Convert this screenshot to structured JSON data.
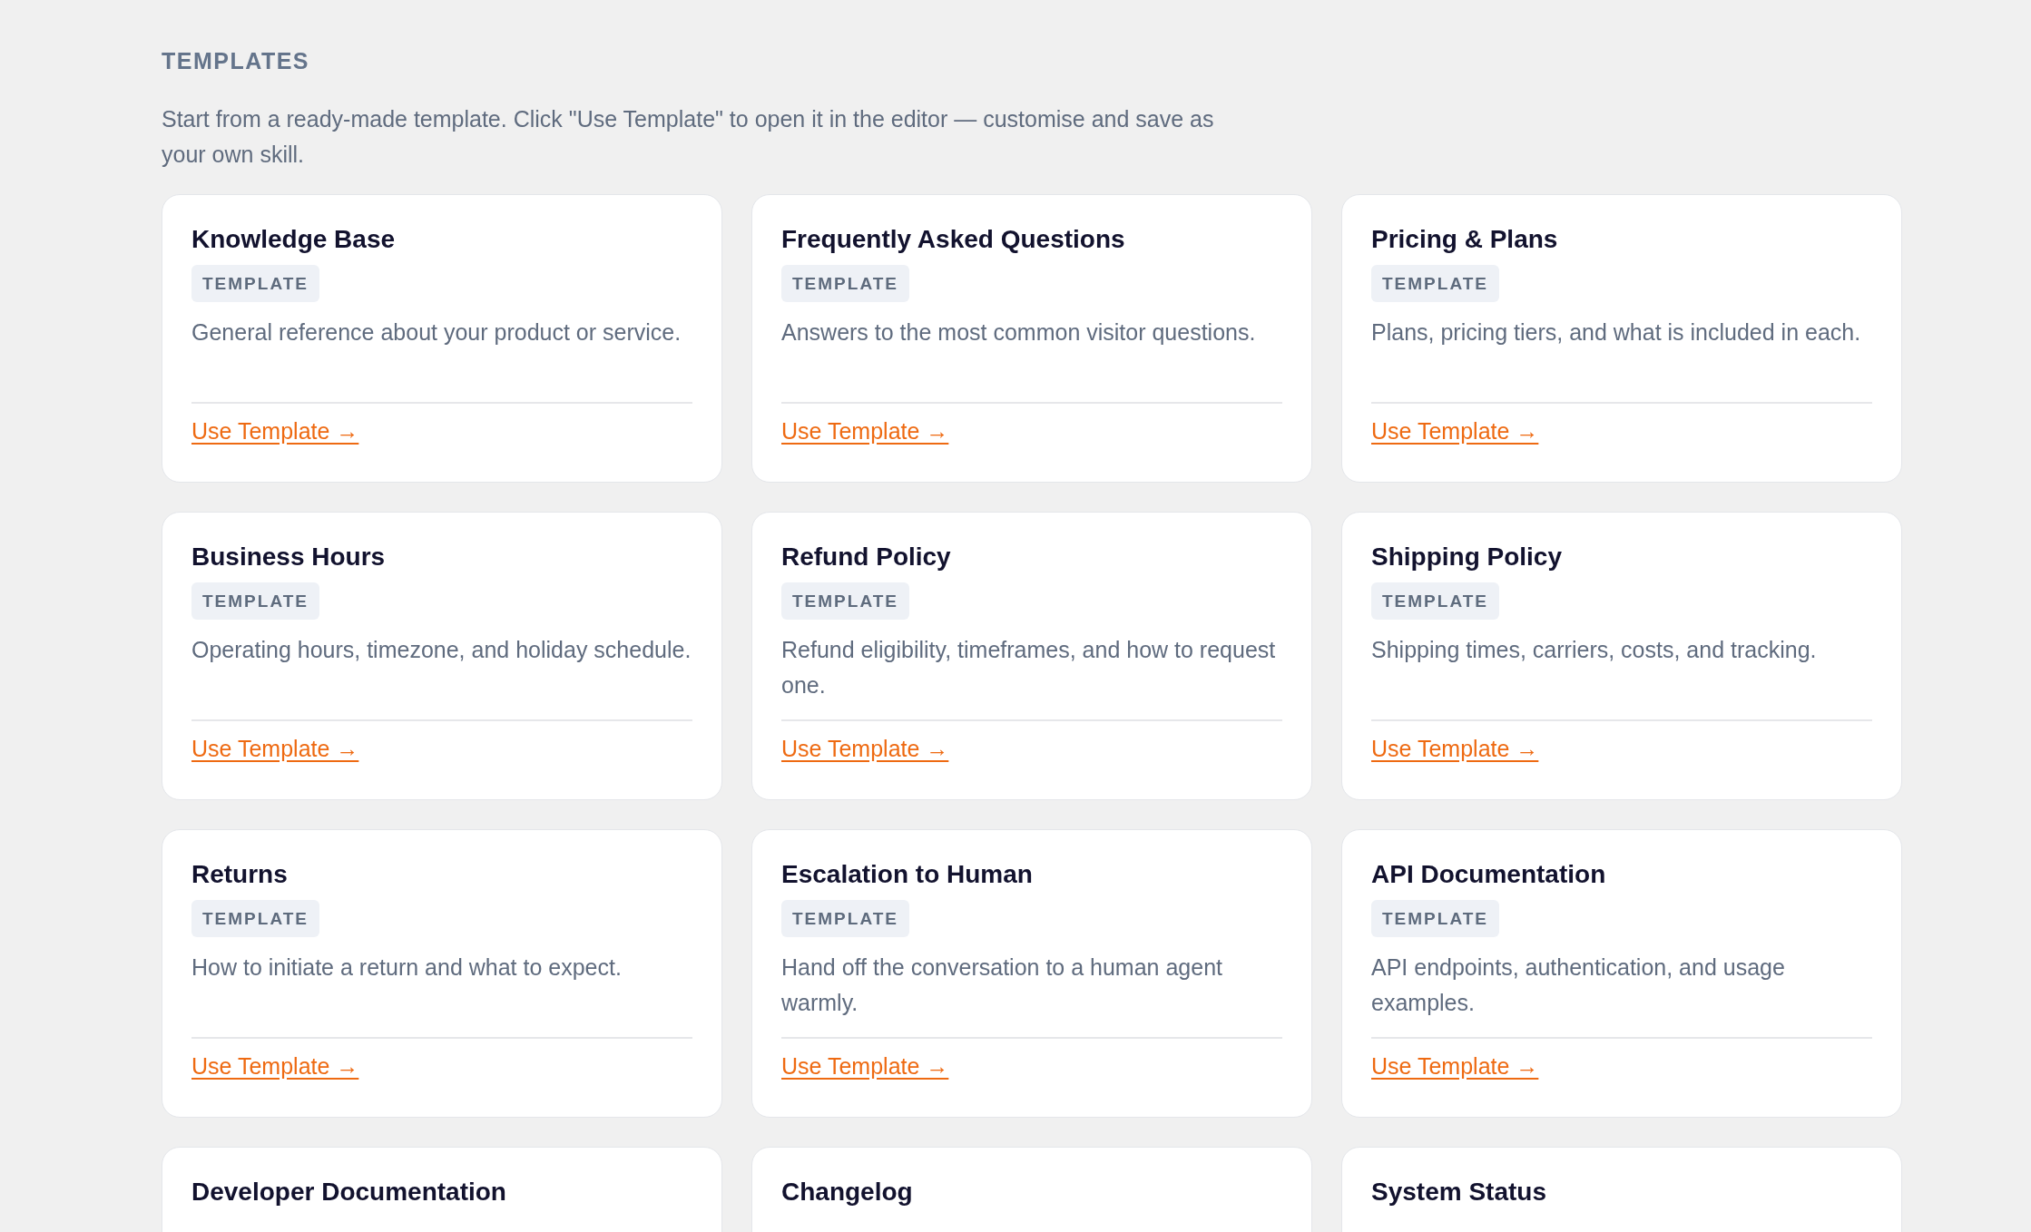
{
  "section": {
    "heading": "TEMPLATES",
    "intro": "Start from a ready-made template. Click \"Use Template\" to open it in the editor — customise and save as your own skill."
  },
  "templates": [
    {
      "title": "Knowledge Base",
      "badge": "TEMPLATE",
      "description": "General reference about your product or service.",
      "link": "Use Template →"
    },
    {
      "title": "Frequently Asked Questions",
      "badge": "TEMPLATE",
      "description": "Answers to the most common visitor questions.",
      "link": "Use Template →"
    },
    {
      "title": "Pricing & Plans",
      "badge": "TEMPLATE",
      "description": "Plans, pricing tiers, and what is included in each.",
      "link": "Use Template →"
    },
    {
      "title": "Business Hours",
      "badge": "TEMPLATE",
      "description": "Operating hours, timezone, and holiday schedule.",
      "link": "Use Template →"
    },
    {
      "title": "Refund Policy",
      "badge": "TEMPLATE",
      "description": "Refund eligibility, timeframes, and how to request one.",
      "link": "Use Template →"
    },
    {
      "title": "Shipping Policy",
      "badge": "TEMPLATE",
      "description": "Shipping times, carriers, costs, and tracking.",
      "link": "Use Template →"
    },
    {
      "title": "Returns",
      "badge": "TEMPLATE",
      "description": "How to initiate a return and what to expect.",
      "link": "Use Template →"
    },
    {
      "title": "Escalation to Human",
      "badge": "TEMPLATE",
      "description": "Hand off the conversation to a human agent warmly.",
      "link": "Use Template →"
    },
    {
      "title": "API Documentation",
      "badge": "TEMPLATE",
      "description": "API endpoints, authentication, and usage examples.",
      "link": "Use Template →"
    },
    {
      "title": "Developer Documentation"
    },
    {
      "title": "Changelog"
    },
    {
      "title": "System Status"
    }
  ]
}
